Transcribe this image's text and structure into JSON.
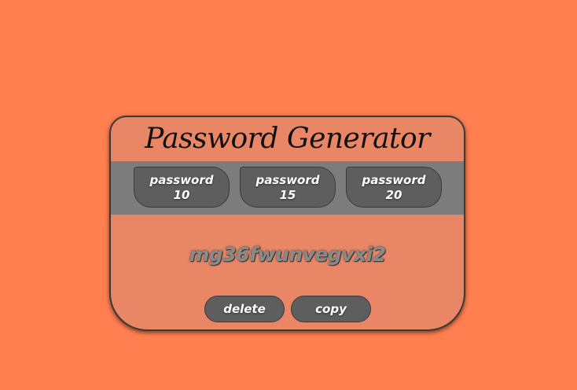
{
  "app": {
    "title": "Password Generator"
  },
  "generators": [
    {
      "label": "password",
      "length": "10"
    },
    {
      "label": "password",
      "length": "15"
    },
    {
      "label": "password",
      "length": "20"
    }
  ],
  "output": {
    "password": "mg36fwunvegvxi2"
  },
  "actions": {
    "delete_label": "delete",
    "copy_label": "copy"
  },
  "colors": {
    "page_background": "#ff7f50",
    "card_background": "#e88665",
    "band_background": "#7c7c7c",
    "button_background": "#5e5e5e"
  }
}
